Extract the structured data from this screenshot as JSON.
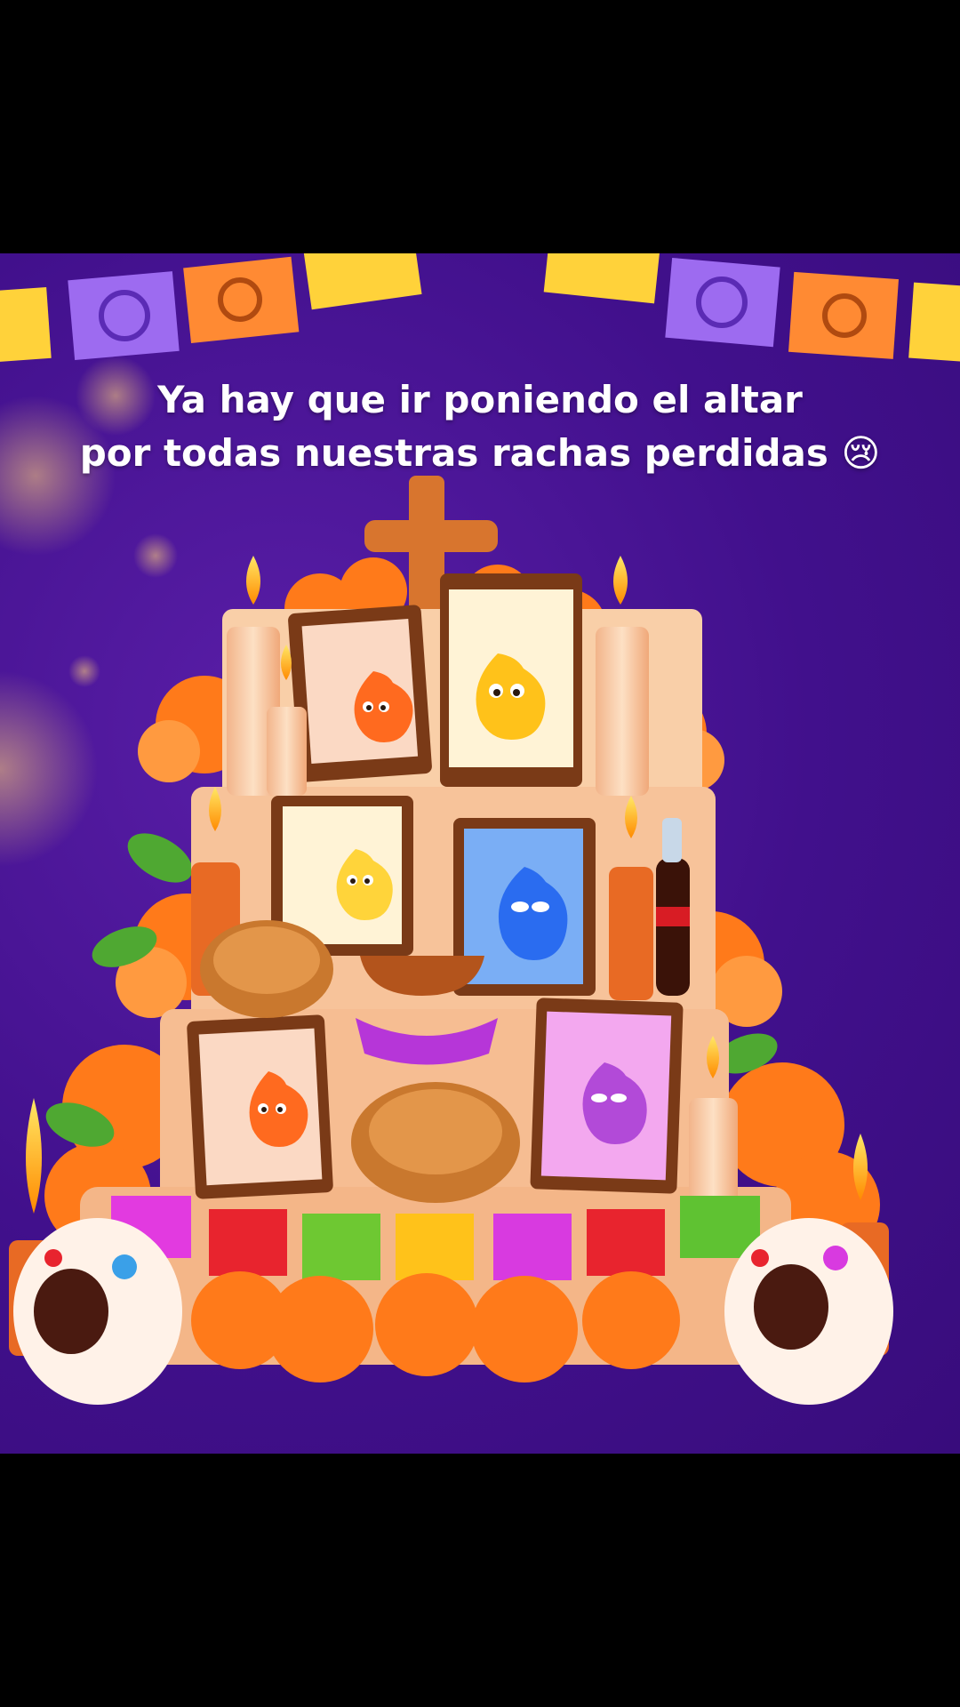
{
  "caption": {
    "line1": "Ya hay que ir poniendo el altar",
    "line2": "por todas nuestras rachas perdidas",
    "emoji": "😢"
  },
  "colors": {
    "background": "#41108c",
    "altar": "#f6c29b",
    "marigold": "#ff7a1a",
    "frame_wood": "#7a3a17"
  },
  "scene": {
    "subject": "día de muertos altar",
    "portraits": [
      {
        "name": "orange-flame-mascot",
        "color": "#ff6a1f"
      },
      {
        "name": "yellow-flame-mascot",
        "color": "#ffc21a"
      },
      {
        "name": "yellow-flame-mascot-small",
        "color": "#ffd43a"
      },
      {
        "name": "blue-flame-mascot",
        "color": "#2a6cf0"
      },
      {
        "name": "orange-flame-mascot-bottom",
        "color": "#ff6a1f"
      },
      {
        "name": "purple-flame-mascot",
        "color": "#b24ad8"
      }
    ]
  }
}
